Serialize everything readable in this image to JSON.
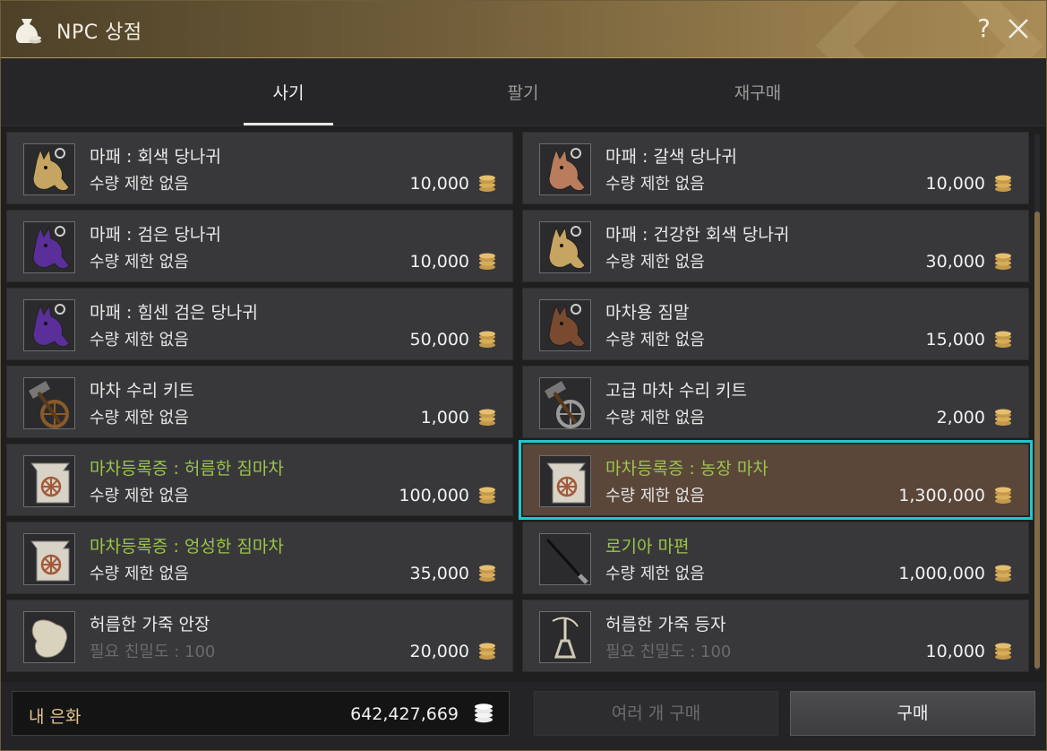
{
  "window": {
    "title": "NPC 상점"
  },
  "tabs": [
    {
      "label": "사기",
      "active": true
    },
    {
      "label": "팔기",
      "active": false
    },
    {
      "label": "재구매",
      "active": false
    }
  ],
  "items": [
    {
      "name": "마패 : 회색 당나귀",
      "limit": "수량 제한 없음",
      "price": "10,000",
      "icon": "gray-donkey-tag-icon",
      "color": "#c6a562",
      "green": false,
      "dim": false
    },
    {
      "name": "마패 : 갈색 당나귀",
      "limit": "수량 제한 없음",
      "price": "10,000",
      "icon": "brown-donkey-tag-icon",
      "color": "#b97c5c",
      "green": false,
      "dim": false
    },
    {
      "name": "마패 : 검은 당나귀",
      "limit": "수량 제한 없음",
      "price": "10,000",
      "icon": "black-donkey-tag-icon",
      "color": "#5a2f9a",
      "green": false,
      "dim": false
    },
    {
      "name": "마패 : 건강한 회색 당나귀",
      "limit": "수량 제한 없음",
      "price": "30,000",
      "icon": "healthy-gray-donkey-tag-icon",
      "color": "#c6a562",
      "green": false,
      "dim": false
    },
    {
      "name": "마패 : 힘센 검은 당나귀",
      "limit": "수량 제한 없음",
      "price": "50,000",
      "icon": "strong-black-donkey-tag-icon",
      "color": "#5a2f9a",
      "green": false,
      "dim": false
    },
    {
      "name": "마차용 짐말",
      "limit": "수량 제한 없음",
      "price": "15,000",
      "icon": "pack-horse-icon",
      "color": "#7a4a30",
      "green": false,
      "dim": false
    },
    {
      "name": "마차 수리 키트",
      "limit": "수량 제한 없음",
      "price": "1,000",
      "icon": "wagon-repair-kit-icon",
      "color": "#8a5a2a",
      "green": false,
      "dim": false
    },
    {
      "name": "고급 마차 수리 키트",
      "limit": "수량 제한 없음",
      "price": "2,000",
      "icon": "advanced-wagon-repair-kit-icon",
      "color": "#9a9a9a",
      "green": false,
      "dim": false
    },
    {
      "name": "마차등록증 : 허름한 짐마차",
      "limit": "수량 제한 없음",
      "price": "100,000",
      "icon": "wagon-registration-icon",
      "color": "#d8d3c6",
      "green": true,
      "dim": false
    },
    {
      "name": "마차등록증 : 농장 마차",
      "limit": "수량 제한 없음",
      "price": "1,300,000",
      "icon": "wagon-registration-icon",
      "color": "#d8d3c6",
      "green": true,
      "dim": false,
      "selected": true
    },
    {
      "name": "마차등록증 : 엉성한 짐마차",
      "limit": "수량 제한 없음",
      "price": "35,000",
      "icon": "wagon-registration-icon",
      "color": "#d8d3c6",
      "green": true,
      "dim": false
    },
    {
      "name": "로기아 마편",
      "limit": "수량 제한 없음",
      "price": "1,000,000",
      "icon": "whip-icon",
      "color": "#1a1a1a",
      "green": true,
      "dim": false
    },
    {
      "name": "허름한 가죽 안장",
      "limit": "필요 친밀도 : 100",
      "price": "20,000",
      "icon": "leather-saddle-icon",
      "color": "#d9d2bd",
      "green": false,
      "dim": true
    },
    {
      "name": "허름한 가죽 등자",
      "limit": "필요 친밀도 : 100",
      "price": "10,000",
      "icon": "leather-stirrup-icon",
      "color": "#cfc8b4",
      "green": false,
      "dim": true
    }
  ],
  "footer": {
    "silver_label": "내 은화",
    "silver_value": "642,427,669",
    "multi_buy_label": "여러 개 구매",
    "buy_label": "구매"
  }
}
